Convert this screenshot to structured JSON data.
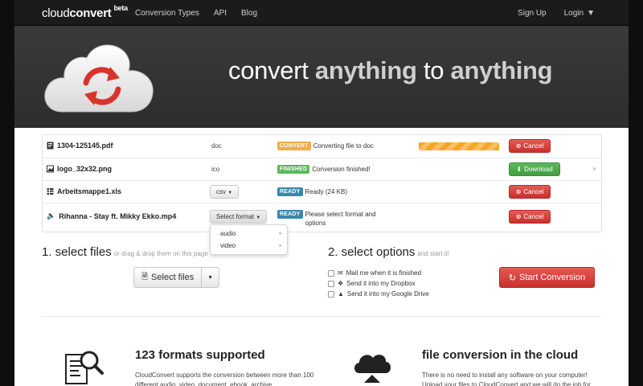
{
  "nav": {
    "brand_cloud": "cloud",
    "brand_convert": "convert",
    "brand_beta": "beta",
    "links": [
      "Conversion Types",
      "API",
      "Blog"
    ],
    "signup": "Sign Up",
    "login": "Login"
  },
  "hero": {
    "w1": "convert ",
    "w2": "anything",
    "w3": " to ",
    "w4": "anything"
  },
  "files": [
    {
      "name": "1304-125145.pdf",
      "format": "doc",
      "badge": "CONVERT",
      "badge_color": "#f0ad4e",
      "status": "Converting file to doc",
      "progress": 1.0,
      "action": "Cancel"
    },
    {
      "name": "logo_32x32.png",
      "format": "ico",
      "badge": "FINISHED",
      "badge_color": "#5cb85c",
      "status": "Conversion finished!",
      "action": "Download",
      "close": "×"
    },
    {
      "name": "Arbeitsmappe1.xls",
      "format": "csv",
      "badge": "READY",
      "badge_color": "#3a87ad",
      "status": "Ready (24 KB)",
      "action": "Cancel"
    },
    {
      "name": "Rihanna - Stay ft. Mikky Ekko.mp4",
      "format": "Select format",
      "badge": "READY",
      "badge_color": "#3a87ad",
      "status": "Please select format and options",
      "action": "Cancel"
    }
  ],
  "dropdown": {
    "items": [
      "audio",
      "video"
    ]
  },
  "step1": {
    "title": "1. select files",
    "hint": "or drag & drop them on this page",
    "button": "Select files"
  },
  "step2": {
    "title": "2. select options",
    "hint": "and start it!",
    "options": [
      "Mail me when it is finished",
      "Send it into my Dropbox",
      "Send it into my Google Drive"
    ],
    "start": "Start Conversion"
  },
  "features": {
    "f1_title": "123 formats supported",
    "f1_text": "CloudConvert supports the conversion between more than 100 different audio, video, document, ebook, archive",
    "f2_title": "file conversion in the cloud",
    "f2_text": "There is no need to install any software on your computer! Upload your files to CloudConvert and we will do the job for"
  }
}
